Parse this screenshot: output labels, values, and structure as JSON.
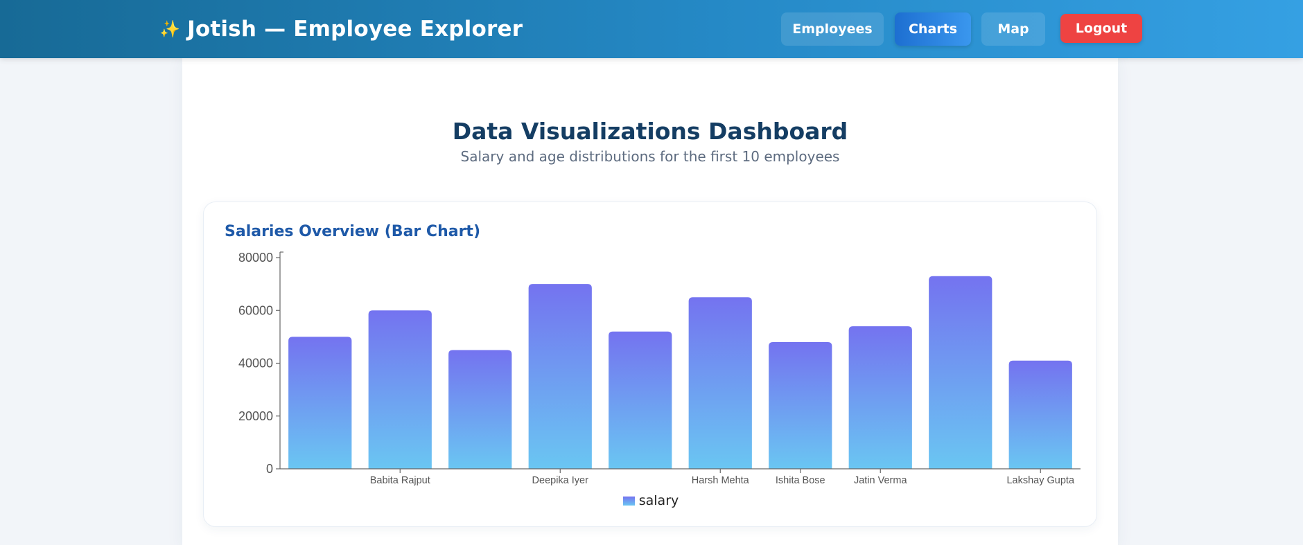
{
  "header": {
    "sparkle_icon": "✨",
    "title": "Jotish — Employee Explorer",
    "nav": [
      {
        "label": "Employees",
        "active": false
      },
      {
        "label": "Charts",
        "active": true
      },
      {
        "label": "Map",
        "active": false
      }
    ],
    "logout_label": "Logout"
  },
  "page": {
    "title": "Data Visualizations Dashboard",
    "subtitle": "Salary and age distributions for the first 10 employees"
  },
  "card": {
    "title": "Salaries Overview (Bar Chart)"
  },
  "colors": {
    "bar_top": "#7473f0",
    "bar_bottom": "#6ac6f2",
    "axis": "#666666",
    "tick_text": "#555555"
  },
  "chart_data": {
    "type": "bar",
    "categories": [
      "",
      "Babita Rajput",
      "",
      "Deepika Iyer",
      "",
      "Harsh Mehta",
      "Ishita Bose",
      "Jatin Verma",
      "",
      "Lakshay Gupta"
    ],
    "series": [
      {
        "name": "salary",
        "values": [
          50000,
          60000,
          45000,
          70000,
          52000,
          65000,
          48000,
          54000,
          73000,
          41000
        ]
      }
    ],
    "yticks": [
      0,
      20000,
      40000,
      60000,
      80000
    ],
    "ylim": [
      0,
      80000
    ],
    "legend": "bottom-center",
    "grid": false
  }
}
